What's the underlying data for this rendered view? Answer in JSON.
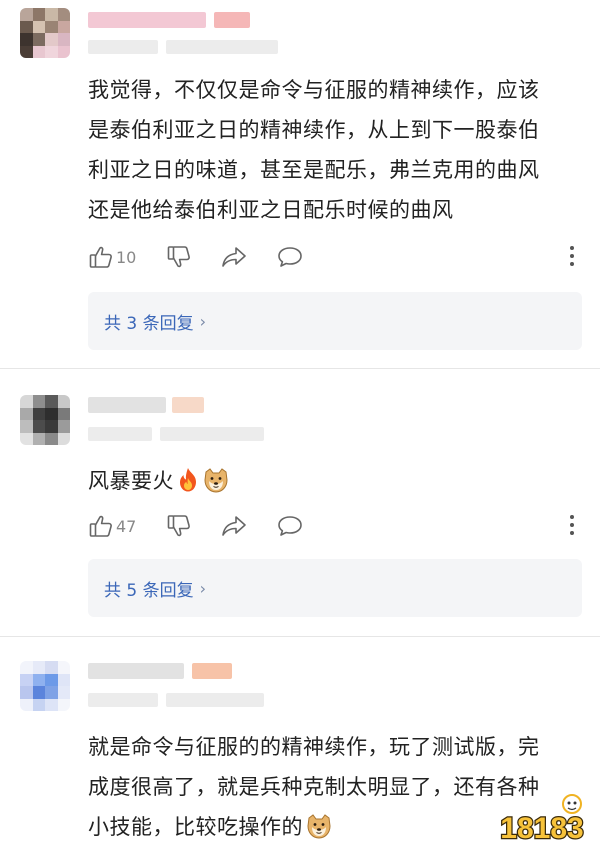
{
  "comments": [
    {
      "text": "我觉得，不仅仅是命令与征服的精神续作，应该\n是泰伯利亚之日的精神续作，从上到下一股泰伯\n利亚之日的味道，甚至是配乐，弗兰克用的曲风\n还是他给泰伯利亚之日配乐时候的曲风",
      "likes": "10",
      "replies": "共 3 条回复"
    },
    {
      "text": "风暴要火",
      "likes": "47",
      "replies": "共 5 条回复"
    },
    {
      "text": "就是命令与征服的的精神续作，玩了测试版，完\n成度很高了，就是兵种克制太明显了，还有各种\n小技能，比较吃操作的"
    }
  ],
  "icons": {
    "like": "thumbs-up-icon",
    "dislike": "thumbs-down-icon",
    "share": "share-icon",
    "reply": "comment-bubble-icon",
    "more": "more-vertical-icon"
  },
  "watermark": {
    "text": "18183"
  },
  "colors": {
    "reply_link": "#3b67b8",
    "reply_bg": "#f4f5f7",
    "divider": "#e6e6e6"
  }
}
